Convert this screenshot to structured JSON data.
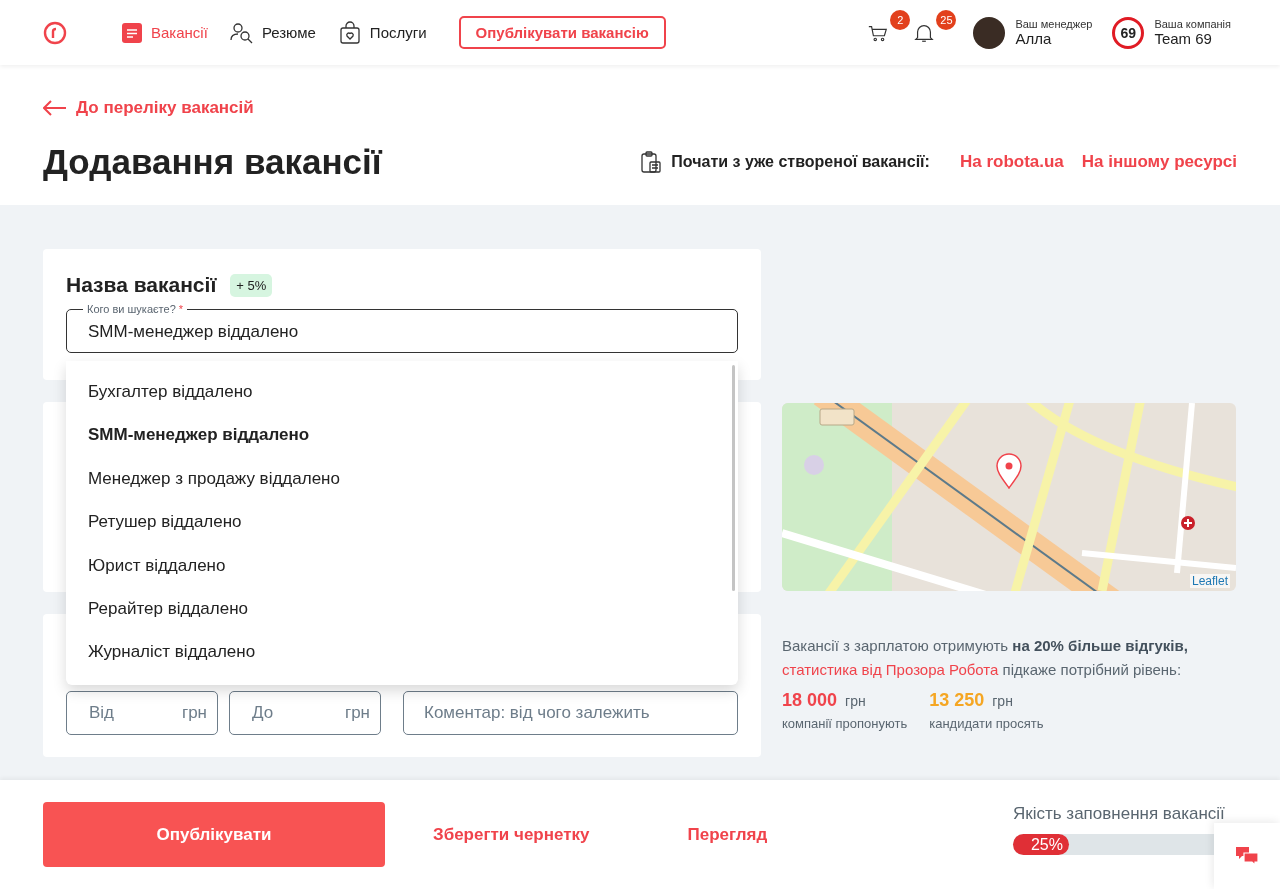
{
  "header": {
    "nav": [
      {
        "label": "Вакансії",
        "selected": true,
        "kind": "doc"
      },
      {
        "label": "Резюме",
        "selected": false,
        "kind": "people"
      },
      {
        "label": "Послуги",
        "selected": false,
        "kind": "bag"
      }
    ],
    "publish_button": "Опублікувати вакансію",
    "cart_count": "2",
    "notifications_count": "25",
    "manager": {
      "caption": "Ваш менеджер",
      "name": "Алла"
    },
    "company": {
      "logo": "69",
      "caption": "Ваша компанія",
      "name": "Team 69"
    }
  },
  "back_link": "До переліку вакансій",
  "title": "Додавання вакансії",
  "start_from": {
    "label": "Почати з уже створеної вакансії:",
    "links": [
      "На robota.ua",
      "На іншому ресурсі"
    ]
  },
  "vacancy_name": {
    "heading": "Назва вакансії",
    "bonus": "+ 5%",
    "field_label": "Кого ви шукаєте?",
    "required_mark": "*",
    "value": "SMM-менеджер віддалено",
    "suggestions": [
      {
        "label": "Бухгалтер віддалено",
        "selected": false
      },
      {
        "label": "SMM-менеджер віддалено",
        "selected": true
      },
      {
        "label": "Менеджер з продажу віддалено",
        "selected": false
      },
      {
        "label": "Ретушер віддалено",
        "selected": false
      },
      {
        "label": "Юрист віддалено",
        "selected": false
      },
      {
        "label": "Рерайтер віддалено",
        "selected": false
      },
      {
        "label": "Журналіст віддалено",
        "selected": false
      }
    ]
  },
  "salary": {
    "from": {
      "placeholder": "Від",
      "unit": "грн"
    },
    "to": {
      "placeholder": "До",
      "unit": "грн"
    },
    "comment": {
      "placeholder": "Коментар: від чого залежить"
    }
  },
  "map": {
    "attribution": "Leaflet"
  },
  "salary_tip": {
    "text": "Вакансії з зарплатою отримують **на 20% більше відгуків,**",
    "link": "статистика від Прозора Робота",
    "text_end": "підкаже потрібний рівень:",
    "stats": [
      {
        "value": "18 000",
        "unit": "грн",
        "caption": "компанії пропонують",
        "color": "#f0434b"
      },
      {
        "value": "13 250",
        "unit": "грн",
        "caption": "кандидати просять",
        "color": "#f5a623"
      }
    ]
  },
  "footer": {
    "publish": "Опублікувати",
    "save_draft": "Зберегти чернетку",
    "preview": "Перегляд",
    "quality": {
      "label": "Якість заповнення вакансії",
      "level": 0.25,
      "reading": "25%"
    }
  }
}
